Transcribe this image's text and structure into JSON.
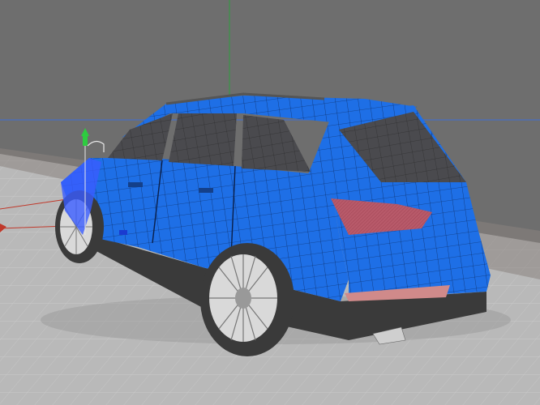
{
  "viewport": {
    "background_color": "#6e6e6e",
    "floor_color": "#b9b9b9",
    "floor_grid_color": "#cfcfcf"
  },
  "axes": {
    "x_axis_color": "#c0392b",
    "y_axis_color": "#2e9e3e",
    "z_axis_color": "#3d6fd6"
  },
  "model": {
    "name_icon": "suv-car-mesh",
    "body_color": "#1e6fe6",
    "wire_color": "#0a1f4a",
    "glass_color": "#4a4a4e",
    "tire_color": "#3a3a3a",
    "rim_color": "#d9d9d9",
    "taillight_color": "#b85a6a",
    "bumper_color": "#444444",
    "reflector_color": "#d08a8a"
  },
  "gizmo": {
    "icon": "move-gizmo-icon",
    "handle_color": "#2ecc40",
    "pivot_color": "#e8e8e8"
  }
}
